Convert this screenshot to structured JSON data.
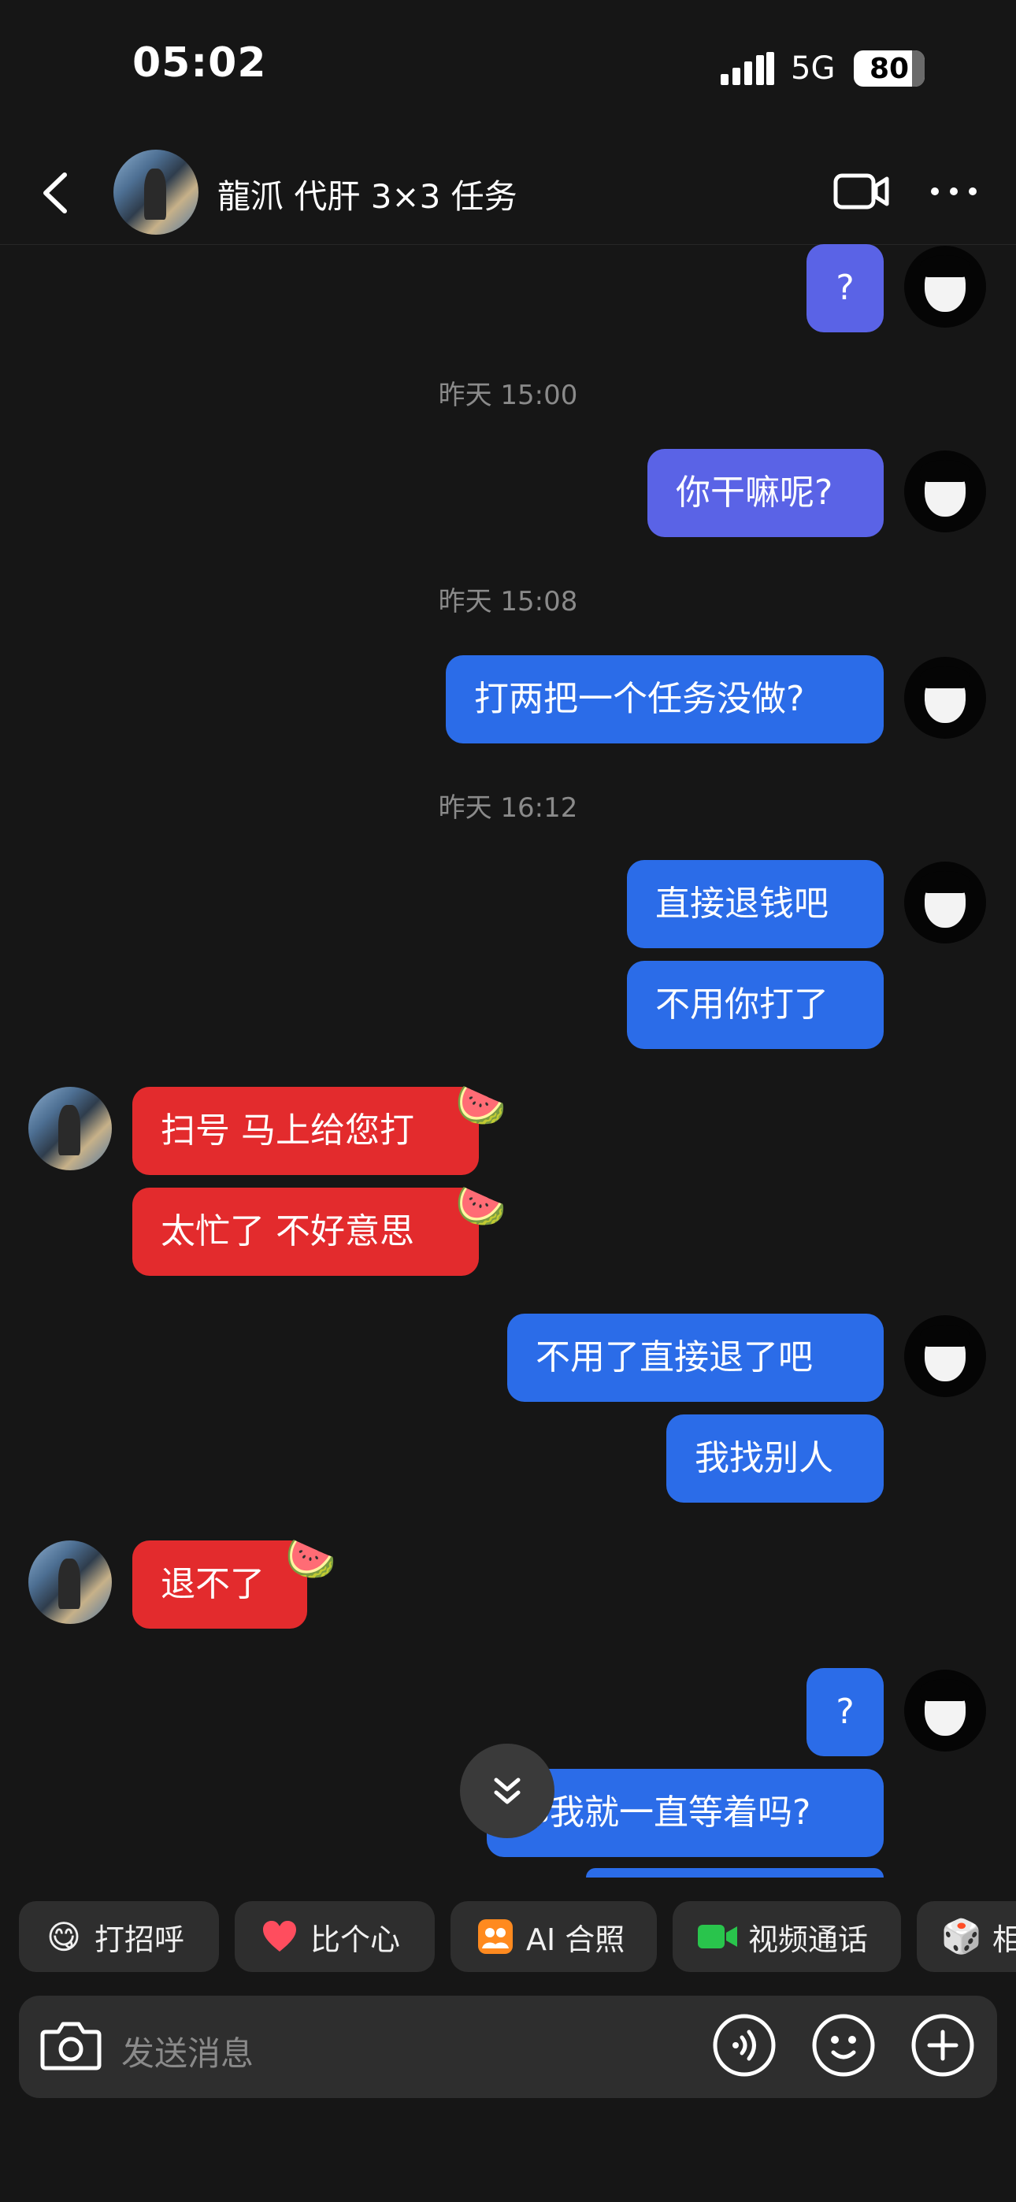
{
  "status_bar": {
    "time": "05:02",
    "network": "5G",
    "battery": "80"
  },
  "header": {
    "contact_name": "龍沠 代肝 3×3 任务"
  },
  "colors": {
    "me_bubble": "#2b6ce8",
    "them_bubble": "#e32b2d",
    "background": "#161616"
  },
  "messages": {
    "m0": "?",
    "t1": "昨天 15:00",
    "m1": "你干嘛呢?",
    "t2": "昨天 15:08",
    "m2": "打两把一个任务没做?",
    "t3": "昨天 16:12",
    "m3": "直接退钱吧",
    "m4": "不用你打了",
    "m5": "扫号 马上给您打",
    "m6": "太忙了 不好意思",
    "m7": "不用了直接退了吧",
    "m8": "我找别人",
    "m9": "退不了",
    "m10": "?",
    "m11": "那我就一直等着吗?"
  },
  "chips": [
    "打招呼",
    "比个心",
    "AI 合照",
    "视频通话",
    "相"
  ],
  "chip_icons": [
    "smile-emoji-icon",
    "heart-icon",
    "ai-photo-icon",
    "video-call-icon",
    "dice-icon"
  ],
  "input": {
    "placeholder": "发送消息"
  }
}
